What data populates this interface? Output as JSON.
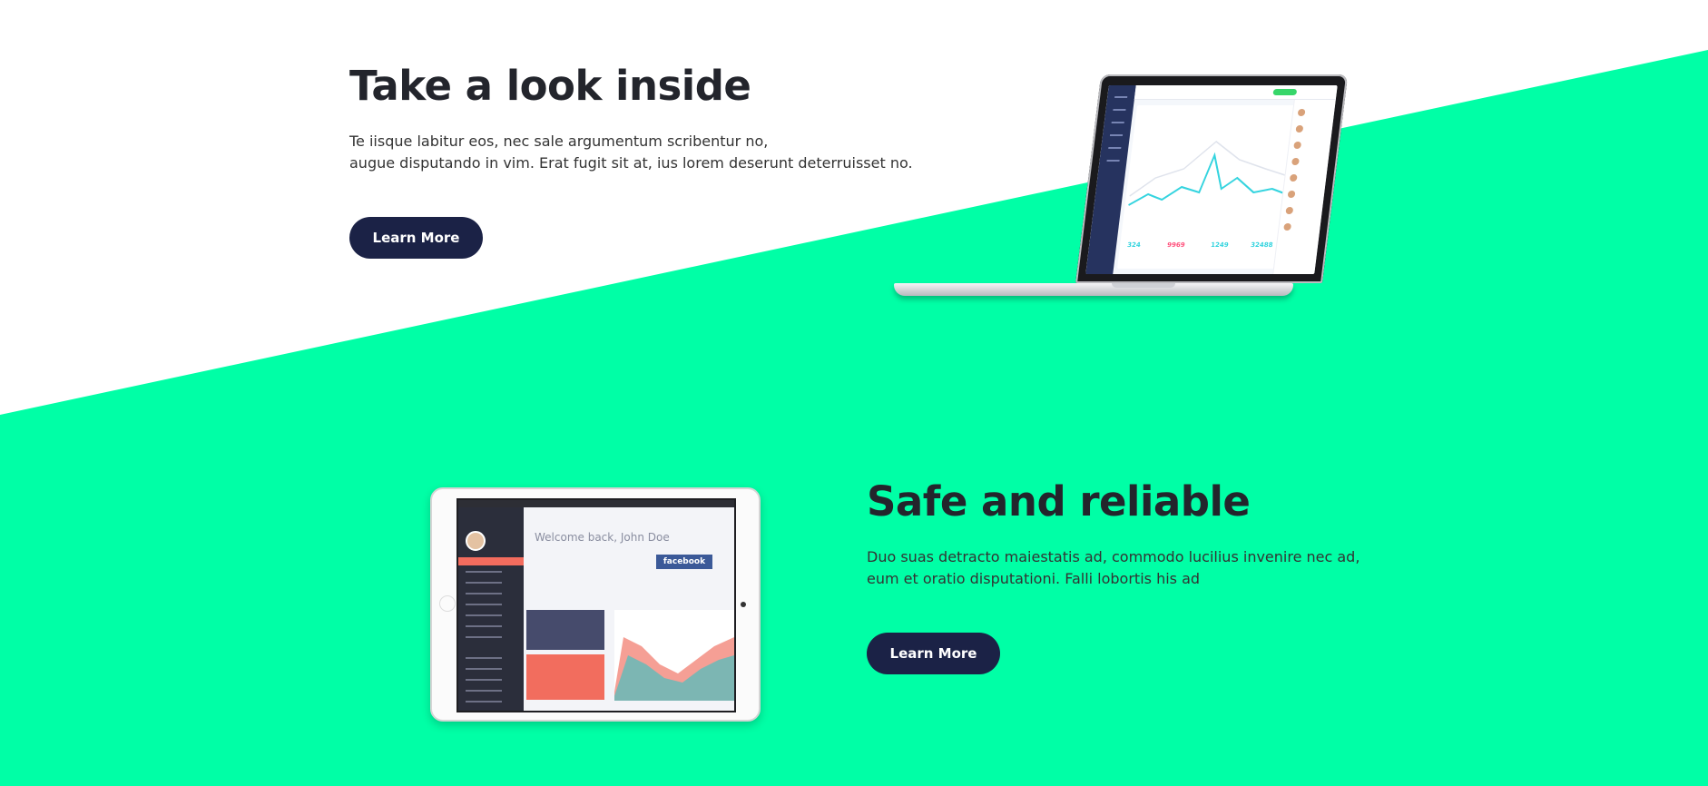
{
  "colors": {
    "accent": "#00ffa6",
    "button": "#1b2246",
    "heading": "#23252c"
  },
  "section1": {
    "title": "Take a look inside",
    "text_line1": "Te iisque labitur eos, nec sale argumentum scribentur no,",
    "text_line2": "augue disputando in vim. Erat fugit sit at, ius lorem deserunt deterruisset no.",
    "button": "Learn More"
  },
  "section2": {
    "title": "Safe and reliable",
    "text_line1": "Duo suas detracto maiestatis ad, commodo lucilius invenire nec ad,",
    "text_line2": "eum et oratio disputationi. Falli lobortis his ad",
    "button": "Learn More"
  },
  "laptop_screen": {
    "stats": [
      "324",
      "9969",
      "1249",
      "32488"
    ]
  },
  "tablet_screen": {
    "welcome": "Welcome back, John Doe",
    "facebook": "facebook"
  }
}
